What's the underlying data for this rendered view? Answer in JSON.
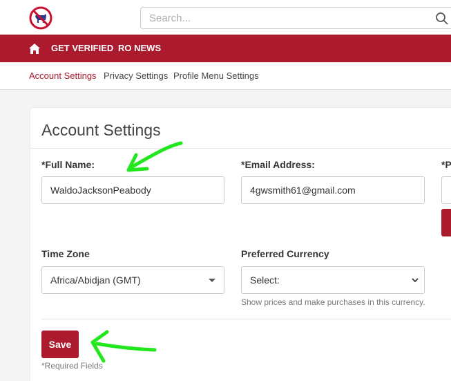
{
  "header": {
    "search_placeholder": "Search...",
    "logo_icon": "donkey-no-icon",
    "search_icon": "search-icon"
  },
  "mainnav": {
    "home_icon": "home-icon",
    "items": [
      "GET VERIFIED",
      "RO NEWS"
    ]
  },
  "subnav": {
    "items": [
      "Account Settings",
      "Privacy Settings",
      "Profile Menu Settings"
    ],
    "active": "Account Settings"
  },
  "form": {
    "title": "Account Settings",
    "full_name": {
      "label": "*Full Name:",
      "value": "WaldoJacksonPeabody"
    },
    "email": {
      "label": "*Email Address:",
      "value": "4gwsmith61@gmail.com"
    },
    "third_label": "*P",
    "time_zone": {
      "label": "Time Zone",
      "value": "Africa/Abidjan (GMT)"
    },
    "currency": {
      "label": "Preferred Currency",
      "value": "Select:",
      "help": "Show prices and make purchases in this currency."
    },
    "save_label": "Save",
    "required_note": "*Required Fields"
  },
  "colors": {
    "brand_red": "#ab1a2d",
    "annotation_green": "#22e61e"
  }
}
